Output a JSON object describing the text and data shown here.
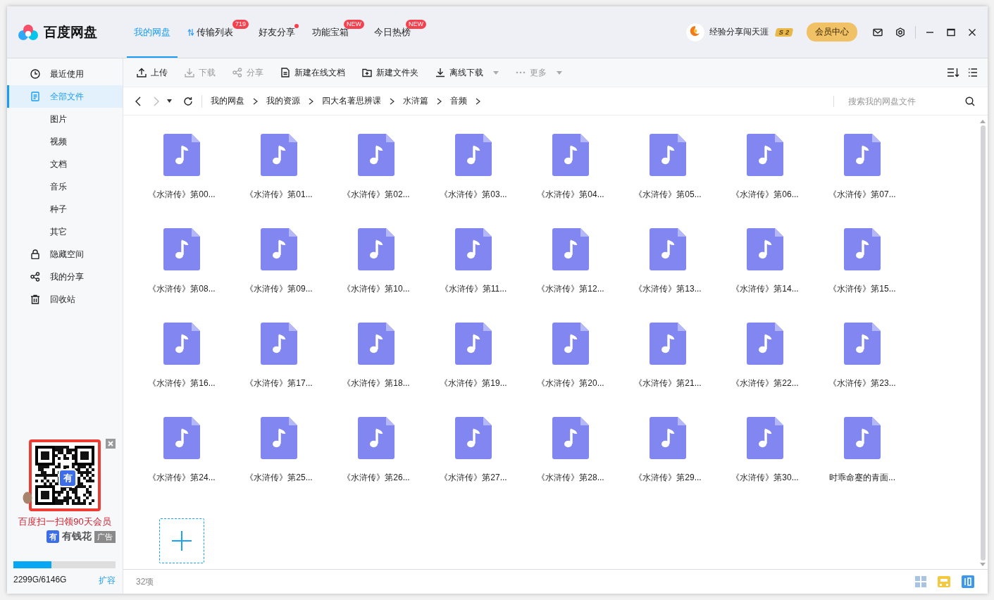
{
  "app": {
    "title": "百度网盘"
  },
  "tabs": [
    {
      "label": "我的网盘",
      "selected": true,
      "dot": false
    },
    {
      "label": "传输列表",
      "selected": false,
      "badge": "719",
      "dot": false
    },
    {
      "label": "好友分享",
      "selected": false,
      "dot": true
    },
    {
      "label": "功能宝箱",
      "selected": false,
      "badge": "NEW",
      "dot": false
    },
    {
      "label": "今日热榜",
      "selected": false,
      "badge": "NEW",
      "dot": false
    }
  ],
  "user": {
    "name": "经验分享闯天涯",
    "level_letter": "S",
    "level_number": "2",
    "vip_button": "会员中心"
  },
  "sidebar": {
    "items": [
      {
        "label": "最近使用",
        "selected": false
      },
      {
        "label": "全部文件",
        "selected": true,
        "children": [
          {
            "label": "图片",
            "selected": false
          },
          {
            "label": "视频",
            "selected": false
          },
          {
            "label": "文档",
            "selected": false
          },
          {
            "label": "音乐",
            "selected": false
          },
          {
            "label": "种子",
            "selected": false
          },
          {
            "label": "其它",
            "selected": false
          }
        ]
      },
      {
        "label": "隐藏空间",
        "selected": false
      },
      {
        "label": "我的分享",
        "selected": false
      },
      {
        "label": "回收站",
        "selected": false
      }
    ]
  },
  "ad": {
    "logo_char": "有",
    "brand_char": "有",
    "headline": "百度扫一扫领90天会员",
    "brand": "有钱花",
    "tag": "广告"
  },
  "storage": {
    "used": "2299G/6146G",
    "level": 0.374,
    "expand_link": "扩容"
  },
  "toolbar": [
    {
      "label": "上传",
      "disabled": false,
      "dropdown": false
    },
    {
      "label": "下载",
      "disabled": true,
      "dropdown": false
    },
    {
      "label": "分享",
      "disabled": true,
      "dropdown": false
    },
    {
      "label": "新建在线文档",
      "disabled": false,
      "dropdown": false
    },
    {
      "label": "新建文件夹",
      "disabled": false,
      "dropdown": false
    },
    {
      "label": "离线下载",
      "disabled": false,
      "dropdown": true
    },
    {
      "label": "更多",
      "disabled": true,
      "dropdown": true
    }
  ],
  "breadcrumb": [
    "我的网盘",
    "我的资源",
    "四大名著思辨课",
    "水浒篇",
    "音频"
  ],
  "search": {
    "placeholder": "搜索我的网盘文件"
  },
  "files": [
    "《水浒传》第00...",
    "《水浒传》第01...",
    "《水浒传》第02...",
    "《水浒传》第03...",
    "《水浒传》第04...",
    "《水浒传》第05...",
    "《水浒传》第06...",
    "《水浒传》第07...",
    "《水浒传》第08...",
    "《水浒传》第09...",
    "《水浒传》第10...",
    "《水浒传》第11...",
    "《水浒传》第12...",
    "《水浒传》第13...",
    "《水浒传》第14...",
    "《水浒传》第15...",
    "《水浒传》第16...",
    "《水浒传》第17...",
    "《水浒传》第18...",
    "《水浒传》第19...",
    "《水浒传》第20...",
    "《水浒传》第21...",
    "《水浒传》第22...",
    "《水浒传》第23...",
    "《水浒传》第24...",
    "《水浒传》第25...",
    "《水浒传》第26...",
    "《水浒传》第27...",
    "《水浒传》第28...",
    "《水浒传》第29...",
    "《水浒传》第30...",
    "时乖命蹇的青面..."
  ],
  "status_bar": {
    "count": "32项"
  }
}
